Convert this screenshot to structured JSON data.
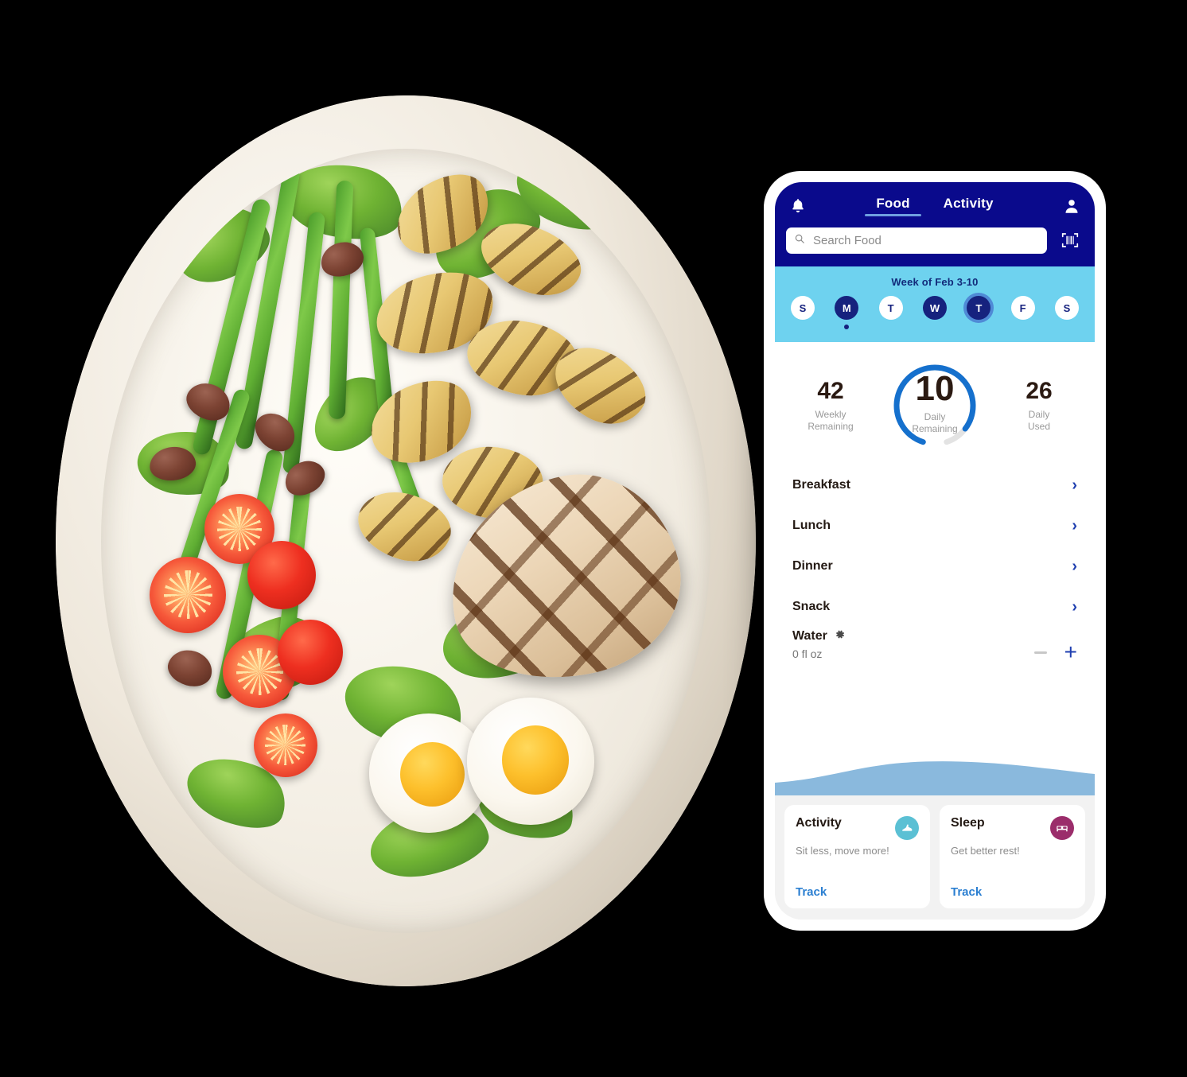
{
  "app": {
    "header": {
      "bell_icon": "bell-icon",
      "profile_icon": "profile-icon",
      "barcode_icon": "barcode-scan-icon",
      "tabs": [
        {
          "label": "Food",
          "active": true
        },
        {
          "label": "Activity",
          "active": false
        }
      ],
      "search": {
        "placeholder": "Search Food",
        "value": "",
        "icon": "search-icon"
      },
      "bg_color": "#0a0a8c"
    },
    "week": {
      "title": "Week of Feb 3-10",
      "bg_color": "#6ed2ef",
      "days": [
        {
          "letter": "S",
          "state": "empty",
          "dot": false
        },
        {
          "letter": "M",
          "state": "filled",
          "dot": true
        },
        {
          "letter": "T",
          "state": "empty",
          "dot": false
        },
        {
          "letter": "W",
          "state": "filled",
          "dot": false
        },
        {
          "letter": "T",
          "state": "today",
          "dot": false
        },
        {
          "letter": "F",
          "state": "empty",
          "dot": false
        },
        {
          "letter": "S",
          "state": "empty",
          "dot": false
        }
      ]
    },
    "stats": {
      "weekly_remaining": {
        "value": "42",
        "label_line1": "Weekly",
        "label_line2": "Remaining"
      },
      "daily_remaining": {
        "value": "10",
        "label_line1": "Daily",
        "label_line2": "Remaining"
      },
      "daily_used": {
        "value": "26",
        "label_line1": "Daily",
        "label_line2": "Used"
      },
      "gauge_color": "#1570cd",
      "gauge_track_color": "#e3e3e3"
    },
    "meals": [
      {
        "name": "Breakfast",
        "chevron": "›"
      },
      {
        "name": "Lunch",
        "chevron": "›"
      },
      {
        "name": "Dinner",
        "chevron": "›"
      },
      {
        "name": "Snack",
        "chevron": "›"
      }
    ],
    "water": {
      "name": "Water",
      "settings_icon": "gear-icon",
      "amount": "0 fl oz",
      "decrement_icon": "minus-icon",
      "increment_icon": "plus-icon",
      "increment_label": "+",
      "wave_color": "#8ab9dd"
    },
    "cards": [
      {
        "title": "Activity",
        "subtitle": "Sit less, move more!",
        "link": "Track",
        "icon": "running-shoe-icon",
        "icon_bg": "#5bc0d4"
      },
      {
        "title": "Sleep",
        "subtitle": "Get better rest!",
        "link": "Track",
        "icon": "bed-icon",
        "icon_bg": "#9b2d6b"
      }
    ]
  },
  "photo": {
    "alt": "Plate of grilled chicken nicoise salad with green beans, potatoes, tomatoes, olives, arugula and soft boiled eggs"
  }
}
